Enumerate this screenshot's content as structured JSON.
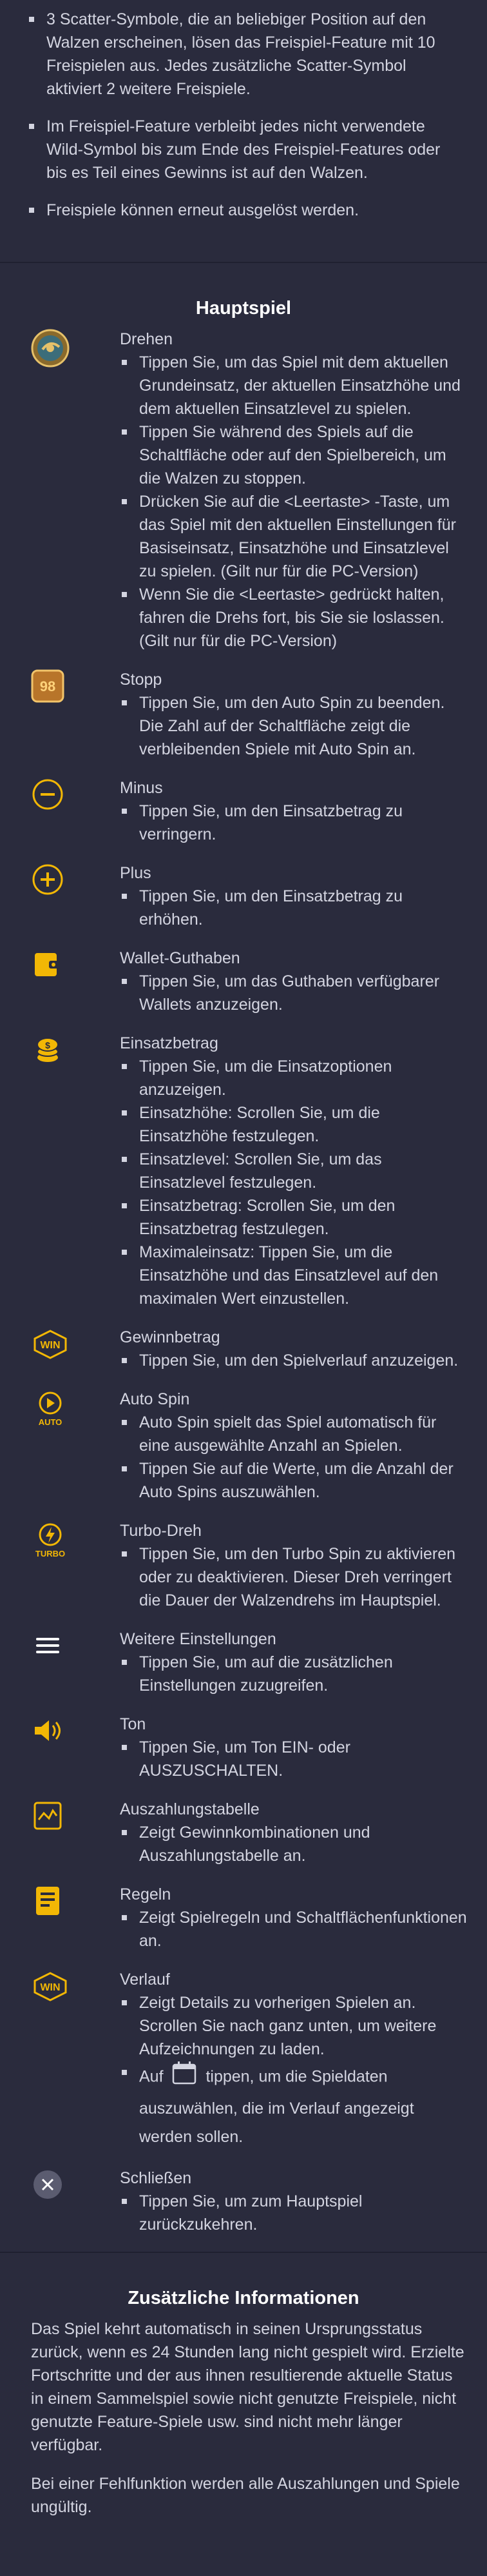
{
  "intro": {
    "bullets": [
      "3 Scatter-Symbole, die an beliebiger Position auf den Walzen erscheinen, lösen das Freispiel-Feature mit 10 Freispielen aus. Jedes zusätzliche Scatter-Symbol aktiviert 2 weitere Freispiele.",
      "Im Freispiel-Feature verbleibt jedes nicht verwendete Wild-Symbol bis zum Ende des Freispiel-Features oder bis es Teil eines Gewinns ist auf den Walzen.",
      "Freispiele können erneut ausgelöst werden."
    ]
  },
  "main_game": {
    "title": "Hauptspiel",
    "controls": [
      {
        "icon": "spin-icon",
        "name": "Drehen",
        "bullets": [
          "Tippen Sie, um das Spiel mit dem aktuellen Grundeinsatz, der aktuellen Einsatzhöhe und dem aktuellen Einsatzlevel zu spielen.",
          "Tippen Sie während des Spiels auf die Schaltfläche oder auf den Spielbereich, um die Walzen zu stoppen.",
          "Drücken Sie auf die <Leertaste> -Taste, um das Spiel mit den aktuellen Einstellungen für Basiseinsatz, Einsatzhöhe und Einsatzlevel zu spielen. (Gilt nur für die PC-Version)",
          "Wenn Sie die <Leertaste> gedrückt halten, fahren die Drehs fort, bis Sie sie loslassen. (Gilt nur für die PC-Version)"
        ]
      },
      {
        "icon": "stop-icon",
        "icon_text": "98",
        "name": "Stopp",
        "bullets": [
          "Tippen Sie, um den Auto Spin zu beenden. Die Zahl auf der Schaltfläche zeigt die verbleibenden Spiele mit Auto Spin an."
        ]
      },
      {
        "icon": "minus-icon",
        "name": "Minus",
        "bullets": [
          "Tippen Sie, um den Einsatzbetrag zu verringern."
        ]
      },
      {
        "icon": "plus-icon",
        "name": "Plus",
        "bullets": [
          "Tippen Sie, um den Einsatzbetrag zu erhöhen."
        ]
      },
      {
        "icon": "wallet-icon",
        "name": "Wallet-Guthaben",
        "bullets": [
          "Tippen Sie, um das Guthaben verfügbarer Wallets anzuzeigen."
        ]
      },
      {
        "icon": "coins-icon",
        "name": "Einsatzbetrag",
        "bullets": [
          "Tippen Sie, um die Einsatzoptionen anzuzeigen.",
          "Einsatzhöhe: Scrollen Sie, um die Einsatzhöhe festzulegen.",
          "Einsatzlevel: Scrollen Sie, um das Einsatzlevel festzulegen.",
          "Einsatzbetrag: Scrollen Sie, um den Einsatzbetrag festzulegen.",
          "Maximaleinsatz: Tippen Sie, um die Einsatzhöhe und das Einsatzlevel auf den maximalen Wert einzustellen."
        ]
      },
      {
        "icon": "win-icon",
        "icon_text": "WIN",
        "name": "Gewinnbetrag",
        "bullets": [
          "Tippen Sie, um den Spielverlauf anzuzeigen."
        ]
      },
      {
        "icon": "auto-spin-icon",
        "icon_text": "AUTO",
        "name": "Auto Spin",
        "bullets": [
          "Auto Spin spielt das Spiel automatisch für eine ausgewählte Anzahl an Spielen.",
          "Tippen Sie auf die Werte, um die Anzahl der Auto Spins auszuwählen."
        ]
      },
      {
        "icon": "turbo-icon",
        "icon_text": "TURBO",
        "name": "Turbo-Dreh",
        "bullets": [
          "Tippen Sie, um den Turbo Spin zu aktivieren oder zu deaktivieren. Dieser Dreh verringert die Dauer der Walzendrehs im Hauptspiel."
        ]
      },
      {
        "icon": "menu-icon",
        "name": "Weitere Einstellungen",
        "bullets": [
          "Tippen Sie, um auf die zusätzlichen Einstellungen zuzugreifen."
        ]
      },
      {
        "icon": "sound-icon",
        "name": "Ton",
        "bullets": [
          "Tippen Sie, um Ton EIN- oder AUSZUSCHALTEN."
        ]
      },
      {
        "icon": "paytable-icon",
        "name": "Auszahlungstabelle",
        "bullets": [
          "Zeigt Gewinnkombinationen und Auszahlungstabelle an."
        ]
      },
      {
        "icon": "rules-icon",
        "name": "Regeln",
        "bullets": [
          "Zeigt Spielregeln und Schaltflächenfunktionen an."
        ]
      },
      {
        "icon": "history-icon",
        "icon_text": "WIN",
        "name": "Verlauf",
        "bullets": [
          "Zeigt Details zu vorherigen Spielen an. Scrollen Sie nach ganz unten, um weitere Aufzeichnungen zu laden."
        ],
        "calendar_before": "Auf",
        "calendar_after": "tippen, um die Spieldaten auszuwählen, die im Verlauf angezeigt werden sollen."
      },
      {
        "icon": "close-icon",
        "name": "Schließen",
        "bullets": [
          "Tippen Sie, um zum Hauptspiel zurückzukehren."
        ]
      }
    ]
  },
  "additional": {
    "title": "Zusätzliche Informationen",
    "paragraphs": [
      "Das Spiel kehrt automatisch in seinen Ursprungsstatus zurück, wenn es 24 Stunden lang nicht gespielt wird. Erzielte Fortschritte und der aus ihnen resultierende aktuelle Status in einem Sammelspiel sowie nicht genutzte Freispiele, nicht genutzte Feature-Spiele usw. sind nicht mehr länger verfügbar.",
      "Bei einer Fehlfunktion werden alle Auszahlungen und Spiele ungültig."
    ]
  },
  "colors": {
    "background": "#2a2b3d",
    "text": "#d3d4e0",
    "heading": "#ffffff",
    "icon_gold": "#f2b705",
    "divider": "#1f2030"
  }
}
